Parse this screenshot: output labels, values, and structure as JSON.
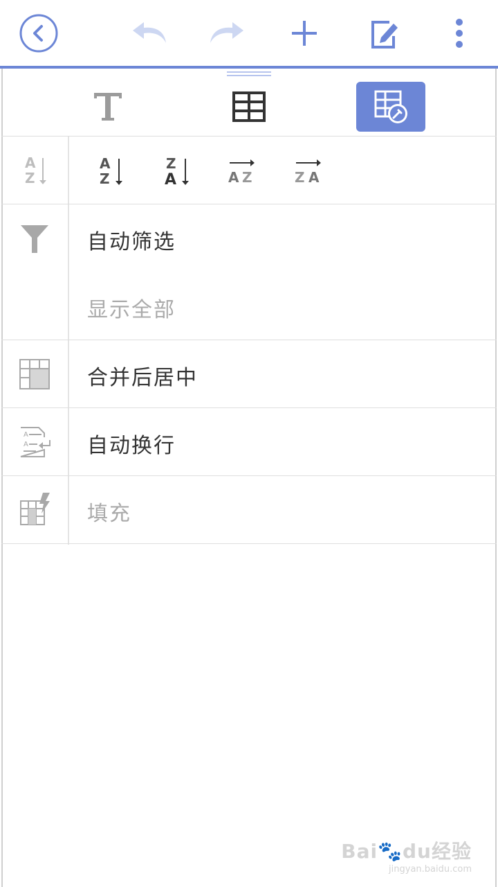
{
  "toolbar": {
    "icons": [
      "back-icon",
      "undo-icon",
      "redo-icon",
      "add-icon",
      "edit-icon",
      "more-icon"
    ]
  },
  "tabs": [
    {
      "name": "text-format",
      "icon": "text-T-icon"
    },
    {
      "name": "table",
      "icon": "table-icon"
    },
    {
      "name": "table-tools",
      "icon": "table-tools-icon",
      "active": true
    }
  ],
  "sort": {
    "buttons": [
      {
        "top": "A",
        "bottom": "Z",
        "dir": "down",
        "disabled": true
      },
      {
        "top": "A",
        "bottom": "Z",
        "dir": "down"
      },
      {
        "top": "Z",
        "bottom": "A",
        "dir": "down"
      },
      {
        "text": "A Z",
        "dir": "right"
      },
      {
        "text": "Z A",
        "dir": "right"
      }
    ]
  },
  "menu": {
    "autofilter": "自动筛选",
    "show_all": "显示全部",
    "merge_center": "合并后居中",
    "auto_wrap": "自动换行",
    "fill": "填充"
  },
  "watermark": {
    "brand": "Bai",
    "brand2": "du",
    "cn": "经验",
    "url": "jingyan.baidu.com"
  },
  "colors": {
    "accent": "#6c86d6",
    "muted": "#aaaaaa",
    "text": "#333333"
  }
}
